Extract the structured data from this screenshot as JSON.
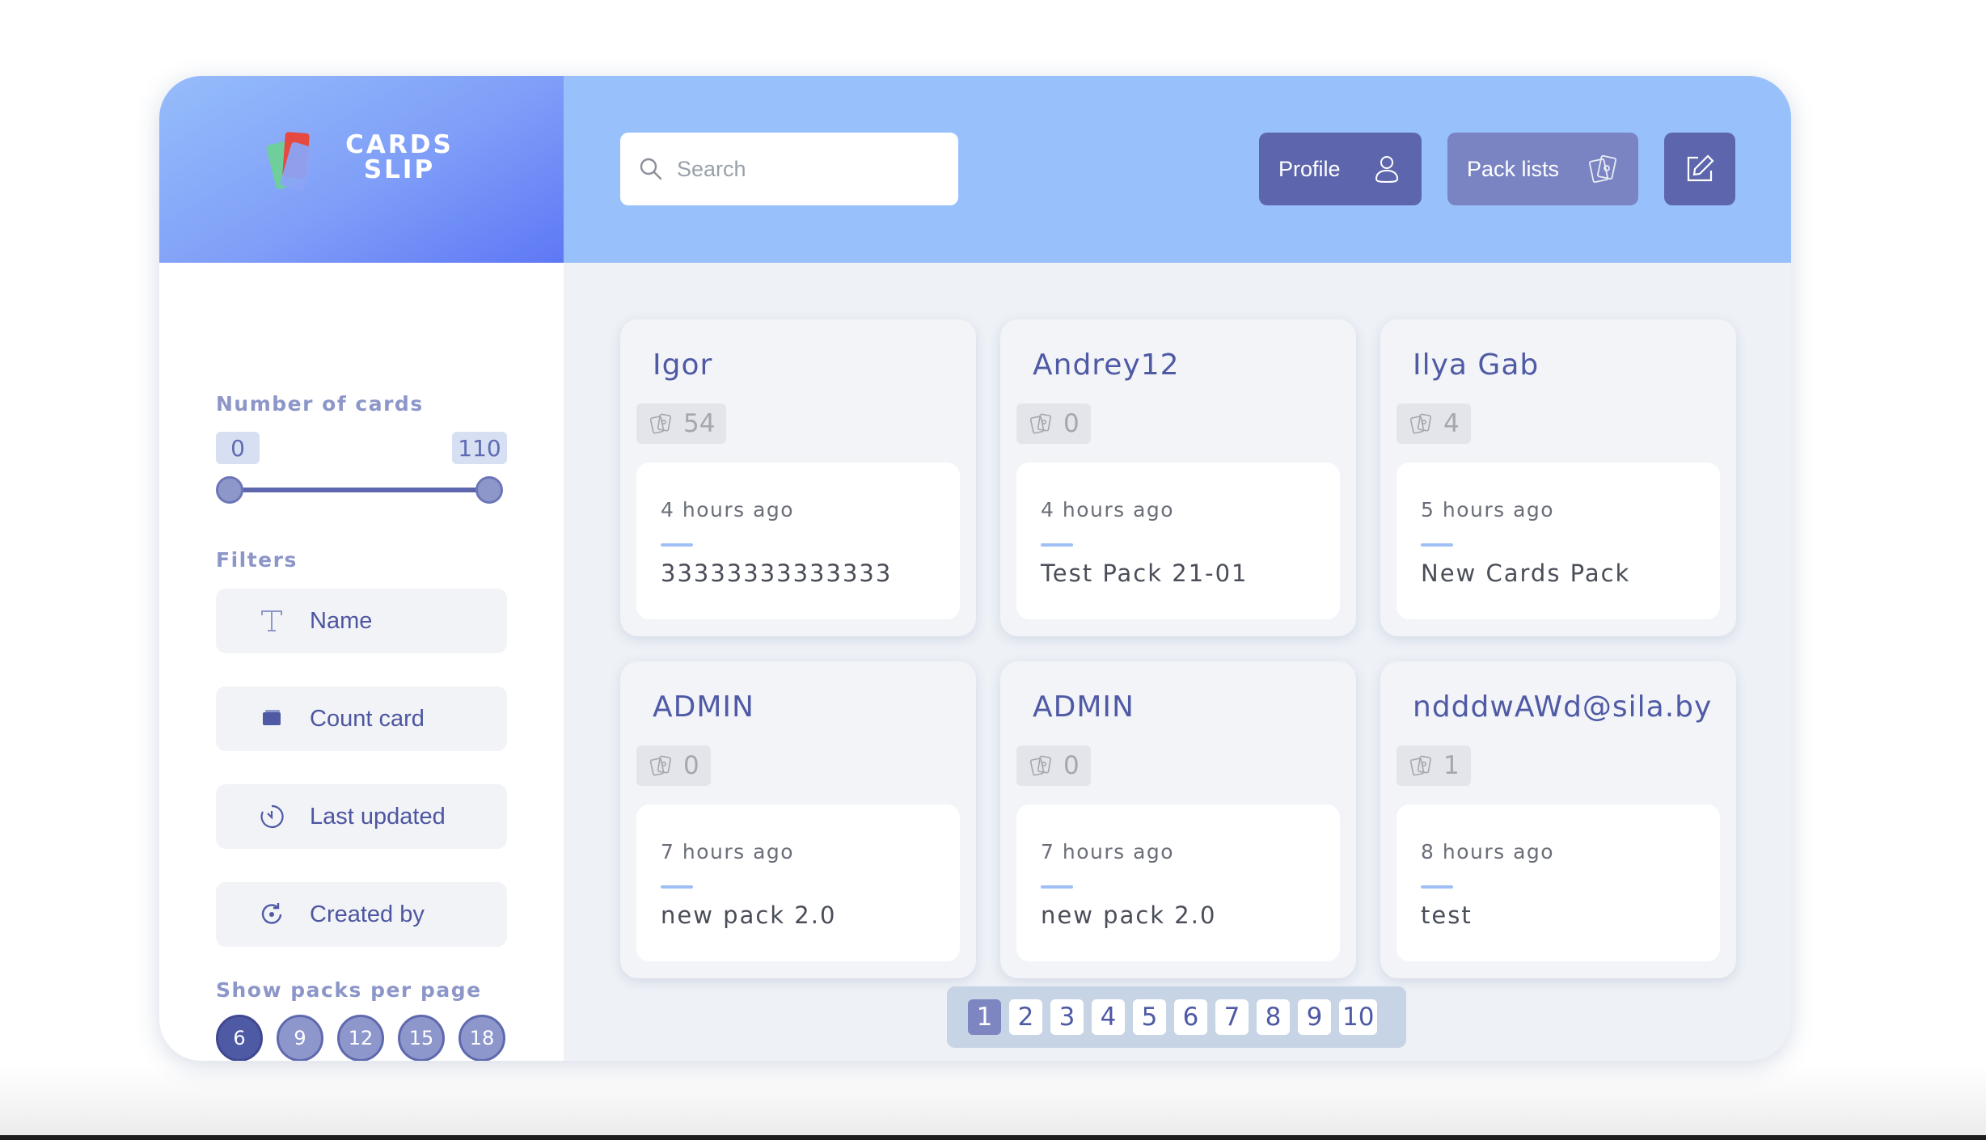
{
  "logo": {
    "line1": "CARDS",
    "line2": "SLIP"
  },
  "search": {
    "placeholder": "Search",
    "value": ""
  },
  "header": {
    "profile_label": "Profile",
    "packs_label": "Pack lists"
  },
  "sidebar": {
    "number_of_cards_label": "Number of cards",
    "range_min": "0",
    "range_max": "110",
    "filters_label": "Filters",
    "filters": [
      {
        "label": "Name",
        "icon": "text-icon"
      },
      {
        "label": "Count card",
        "icon": "card-icon"
      },
      {
        "label": "Last updated",
        "icon": "clock-icon"
      },
      {
        "label": "Created by",
        "icon": "refresh-icon"
      }
    ],
    "per_page_label": "Show packs per page",
    "per_page_options": [
      "6",
      "9",
      "12",
      "15",
      "18"
    ],
    "per_page_selected": "6"
  },
  "packs": [
    {
      "user": "Igor",
      "count": "54",
      "updated": "4 hours ago",
      "name": "33333333333333"
    },
    {
      "user": "Andrey12",
      "count": "0",
      "updated": "4 hours ago",
      "name": "Test Pack 21-01"
    },
    {
      "user": "Ilya Gab",
      "count": "4",
      "updated": "5 hours ago",
      "name": "New Cards Pack"
    },
    {
      "user": "ADMIN",
      "count": "0",
      "updated": "7 hours ago",
      "name": "new pack 2.0"
    },
    {
      "user": "ADMIN",
      "count": "0",
      "updated": "7 hours ago",
      "name": "new pack 2.0"
    },
    {
      "user": "ndddwAWd@sila.by",
      "count": "1",
      "updated": "8 hours ago",
      "name": "test"
    }
  ],
  "pagination": {
    "pages": [
      "1",
      "2",
      "3",
      "4",
      "5",
      "6",
      "7",
      "8",
      "9",
      "10"
    ],
    "current": "1"
  },
  "colors": {
    "header_bg": "#98c0fb",
    "primary": "#5d66ac",
    "accent_text": "#4f5aa5"
  }
}
